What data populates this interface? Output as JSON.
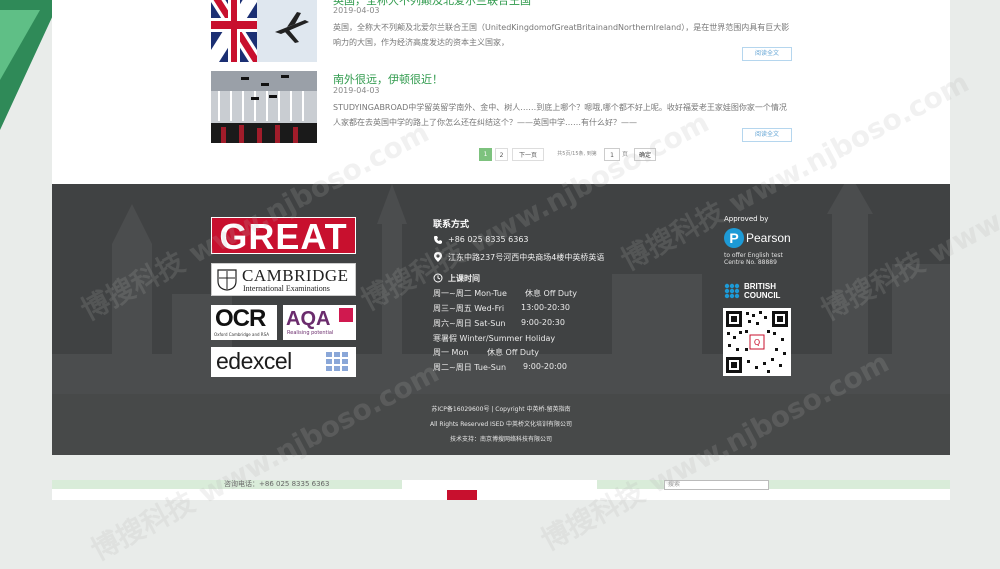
{
  "articles": [
    {
      "title": "英国，全称大不列颠及北爱尔兰联合王国",
      "date": "2019-04-03",
      "summary": "英国，全称大不列颠及北爱尔兰联合王国（UnitedKingdomofGreatBritainandNorthernIreland），是在世界范围内具有巨大影响力的大国，作为经济高度发达的资本主义国家，",
      "read_more": "阅读全文",
      "thumb_icon": "union-jack-airplane-image"
    },
    {
      "title": "南外很远，伊顿很近！",
      "date": "2019-04-03",
      "summary": "STUDYINGABROAD中学留英留学南外、金中、树人……到底上哪个？嗯哦,哪个都不好上呢。收好福爱老王家娃图你家一个情况人家都在去英国中学的路上了你怎么还在纠结这个？——英国中学……有什么好？——",
      "read_more": "阅读全文",
      "thumb_icon": "graduation-caps-image"
    }
  ],
  "pagination": {
    "current": "1",
    "next_num": "2",
    "next_label": "下一页",
    "info": "共5页/15条, 到第",
    "input_value": "1",
    "page_unit": "页",
    "confirm": "确定"
  },
  "footer": {
    "logos": {
      "great": "GREAT",
      "cambridge_main": "CAMBRIDGE",
      "cambridge_sub": "International Examinations",
      "ocr_main": "OCR",
      "ocr_sub": "Oxford Cambridge and RSA",
      "aqa_main": "AQA",
      "aqa_sub": "Realising potential",
      "edexcel": "edexcel"
    },
    "contact": {
      "title": "联系方式",
      "phone": "+86 025 8335 6363",
      "address": "江东中路237号河西中央商场4楼中英桥英语",
      "hours_title": "上课时间",
      "hours": [
        {
          "day": "周一~周二 Mon-Tue",
          "time": "休息 Off Duty"
        },
        {
          "day": "周三~周五 Wed-Fri",
          "time": "13:00-20:30"
        },
        {
          "day": "周六~周日 Sat-Sun",
          "time": "9:00-20:30"
        },
        {
          "day": "寒暑假 Winter/Summer Holiday",
          "time": ""
        },
        {
          "day": "周一 Mon",
          "time": "休息 Off Duty"
        },
        {
          "day": "周二~周日 Tue-Sun",
          "time": "9:00-20:00"
        }
      ]
    },
    "approved_by": "Approved by",
    "pearson": "Pearson",
    "pearson_sub": "to offer English test Centre No. 88889",
    "british_council": "BRITISH COUNCIL",
    "legal": [
      "苏ICP备16029600号 | Copyright 中英桥-留英指南",
      "All Rights Reserved ISED 中英桥文化培训有限公司",
      "技术支持：南京博搜网络科技有限公司"
    ]
  },
  "bottom_strip": {
    "phone": "咨询电话：+86 025 8335 6363",
    "search_placeholder": "搜索"
  },
  "watermark": "博搜科技 www.njboso.com",
  "colors": {
    "accent_green": "#2f9a4c",
    "footer_bg": "#404243",
    "great_red": "#c8102e",
    "pearson_blue": "#1d9ad6"
  }
}
